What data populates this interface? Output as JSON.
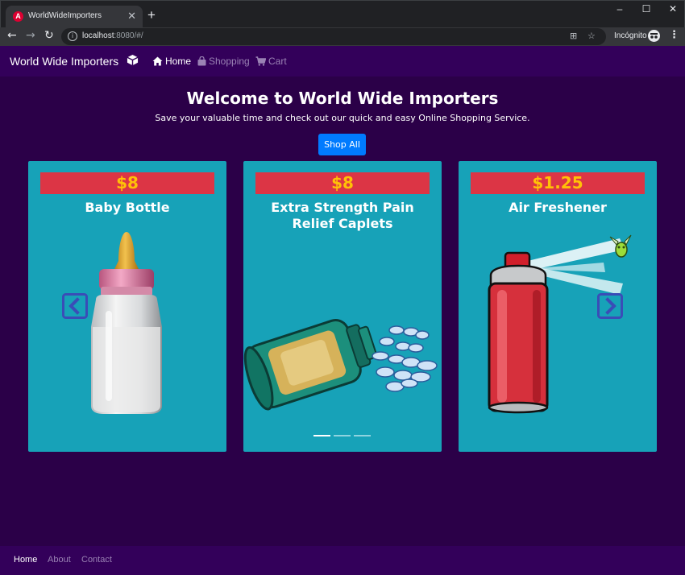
{
  "browser": {
    "tab_title": "WorldWideImporters",
    "url_host": "localhost",
    "url_rest": ":8080/#/",
    "profile_label": "Incógnito"
  },
  "navbar": {
    "brand": "World Wide Importers",
    "links": [
      {
        "label": "Home",
        "icon": "home-icon",
        "active": true
      },
      {
        "label": "Shopping",
        "icon": "shopping-bag-icon",
        "active": false
      },
      {
        "label": "Cart",
        "icon": "cart-icon",
        "active": false
      }
    ]
  },
  "hero": {
    "title": "Welcome to World Wide Importers",
    "subtitle": "Save your valuable time and check out our quick and easy Online Shopping Service.",
    "cta_label": "Shop All"
  },
  "products": [
    {
      "price": "$8",
      "name": "Baby Bottle",
      "image": "baby-bottle-image"
    },
    {
      "price": "$8",
      "name": "Extra Strength Pain Relief Caplets",
      "image": "pill-bottle-image"
    },
    {
      "price": "$1.25",
      "name": "Air Freshener",
      "image": "air-freshener-can-image"
    }
  ],
  "carousel": {
    "slides": 3,
    "active_index": 0
  },
  "footer": {
    "links": [
      {
        "label": "Home",
        "active": true
      },
      {
        "label": "About",
        "active": false
      },
      {
        "label": "Contact",
        "active": false
      }
    ]
  },
  "colors": {
    "page_bg": "#2b0048",
    "navbar_bg": "#33005a",
    "card_bg": "#17a2b8",
    "price_bg": "#dc3545",
    "price_text": "#ffc107",
    "button_bg": "#007bff"
  }
}
